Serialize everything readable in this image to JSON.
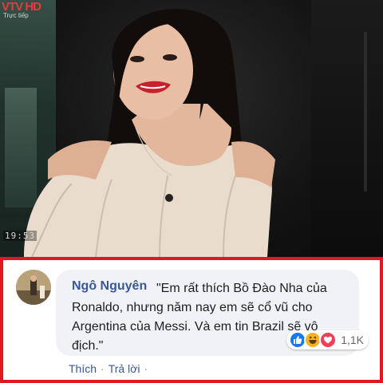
{
  "video": {
    "logo": "VTV HD",
    "logo_sub": "Trực tiếp",
    "timestamp": "19:53"
  },
  "comment": {
    "author": "Ngô Nguyên",
    "text": "\"Em rất thích Bồ Đào Nha của Ronaldo, nhưng năm nay em sẽ cổ vũ cho Argentina của Messi. Và em tin Brazil sẽ vô địch.\"",
    "reactions": {
      "icons": [
        "like-icon",
        "haha-icon",
        "love-icon"
      ],
      "count": "1,1K"
    },
    "actions": {
      "like": "Thích",
      "reply": "Trả lời",
      "separator": "·"
    }
  },
  "colors": {
    "border": "#e0181f",
    "author": "#385898",
    "bubble": "#f0f2f5",
    "like": "#1877f2",
    "haha": "#f7b125",
    "love": "#f33e58"
  }
}
